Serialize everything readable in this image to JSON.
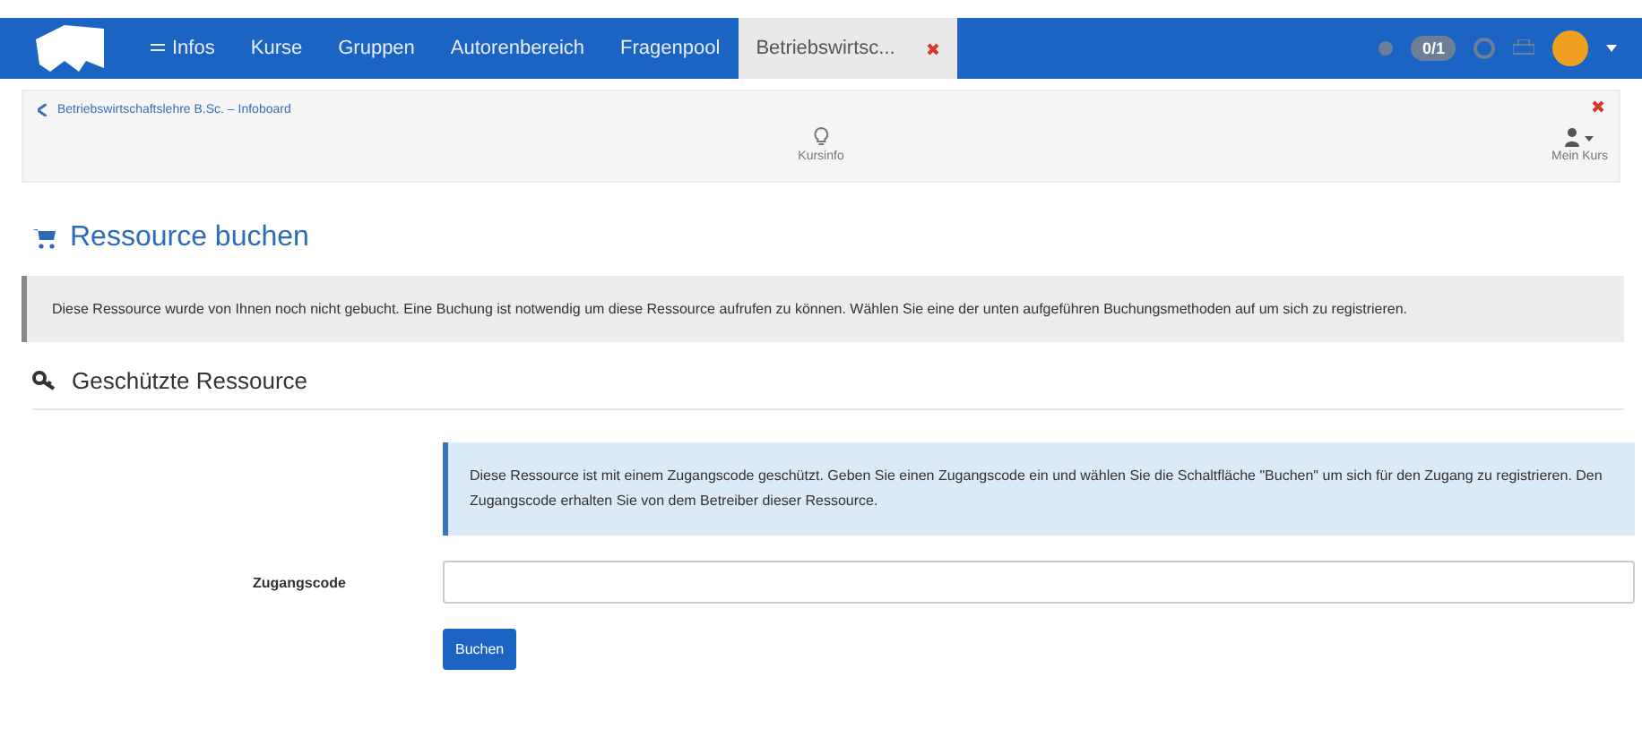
{
  "navbar": {
    "items": [
      {
        "label": "Infos",
        "kind": "menu",
        "selected": false
      },
      {
        "label": "Kurse",
        "kind": "link",
        "selected": false
      },
      {
        "label": "Gruppen",
        "kind": "link",
        "selected": false
      },
      {
        "label": "Autorenbereich",
        "kind": "link",
        "selected": false
      },
      {
        "label": "Fragenpool",
        "kind": "link",
        "selected": false
      },
      {
        "label": "Betriebswirtsc...",
        "kind": "tab",
        "selected": true
      }
    ],
    "badge": "0/1"
  },
  "course_bar": {
    "breadcrumb": "Betriebswirtschaftslehre B.Sc. – Infoboard",
    "tools": [
      {
        "label": "Kursinfo",
        "kind": "info"
      },
      {
        "label": "Mein Kurs",
        "kind": "user"
      }
    ]
  },
  "page_title": "Ressource buchen",
  "notice": "Diese Ressource wurde von Ihnen noch nicht gebucht. Eine Buchung ist notwendig um diese Ressource aufrufen zu können. Wählen Sie eine der unten aufgeführen Buchungsmethoden auf um sich zu registrieren.",
  "section_title": "Geschützte Ressource",
  "info": "Diese Ressource ist mit einem Zugangscode geschützt. Geben Sie einen Zugangscode ein und wählen Sie die Schaltfläche \"Buchen\" um sich für den Zugang zu registrieren. Den Zugangscode erhalten Sie von dem Betreiber dieser Ressource.",
  "form": {
    "label": "Zugangscode",
    "button": "Buchen"
  }
}
